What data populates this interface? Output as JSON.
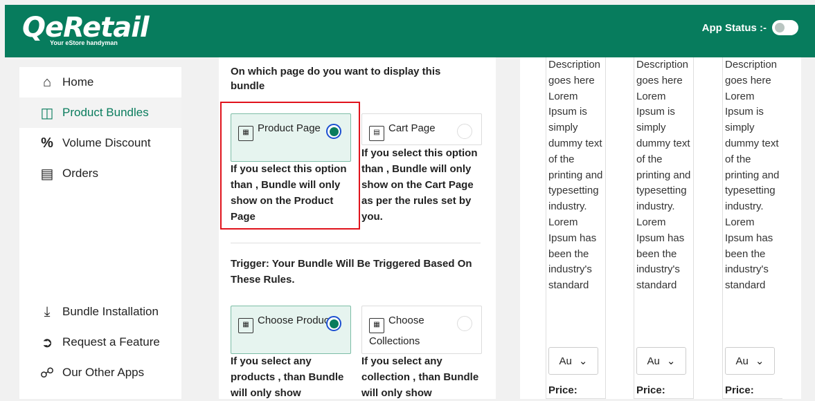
{
  "header": {
    "logo_text": "eRetail",
    "logo_tagline": "Your eStore handyman",
    "app_status_label": "App Status :-"
  },
  "sidebar": {
    "items": [
      {
        "label": "Home",
        "icon": "home-icon"
      },
      {
        "label": "Product Bundles",
        "icon": "gift-icon"
      },
      {
        "label": "Volume Discount",
        "icon": "percent-icon"
      },
      {
        "label": "Orders",
        "icon": "cart-icon"
      },
      {
        "label": "Bundle Installation",
        "icon": "download-icon"
      },
      {
        "label": "Request a Feature",
        "icon": "arrow-circle-icon"
      },
      {
        "label": "Our Other Apps",
        "icon": "link-icon"
      }
    ]
  },
  "main": {
    "page_question": "On which page do you want to display this bundle",
    "product_page": {
      "label": "Product Page",
      "desc": "If you select this option than , Bundle will only show on the Product Page"
    },
    "cart_page": {
      "label": "Cart Page",
      "desc": "If you select this option than , Bundle will only show on the Cart Page as per the rules set by you."
    },
    "trigger_heading": "Trigger: Your Bundle Will Be Triggered Based On These Rules.",
    "choose_products": {
      "label": "Choose Products",
      "desc": "If you select any products , than Bundle will only show"
    },
    "choose_collections": {
      "label": "Choose Collections",
      "desc": "If you select any collection , than Bundle will only show"
    }
  },
  "preview": {
    "desc_text": "Description goes here Lorem Ipsum is simply dummy text of the printing and typesetting industry. Lorem Ipsum has been the industry's standard",
    "select_value": "Au",
    "price_label": "Price:"
  },
  "colors": {
    "brand": "#077c5d",
    "highlight": "#e0121b"
  }
}
